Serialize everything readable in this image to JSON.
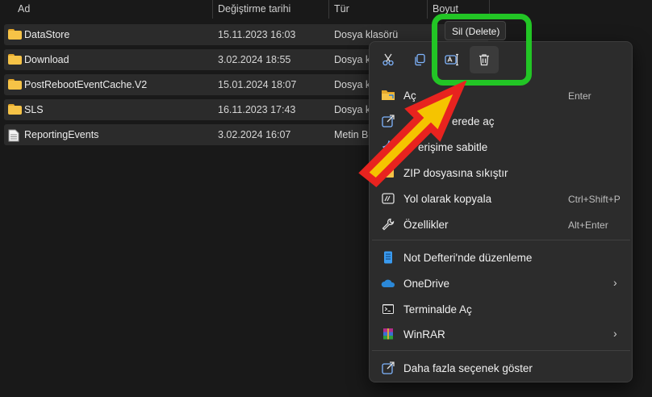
{
  "columns": {
    "name": "Ad",
    "modified": "Değiştirme tarihi",
    "type": "Tür",
    "size": "Boyut"
  },
  "files": [
    {
      "name": "DataStore",
      "date": "15.11.2023 16:03",
      "type": "Dosya klasörü",
      "icon": "folder-icon"
    },
    {
      "name": "Download",
      "date": "3.02.2024 18:55",
      "type": "Dosya kl",
      "icon": "folder-icon"
    },
    {
      "name": "PostRebootEventCache.V2",
      "date": "15.01.2024 18:07",
      "type": "Dosya kl",
      "icon": "folder-icon"
    },
    {
      "name": "SLS",
      "date": "16.11.2023 17:43",
      "type": "Dosya kl",
      "icon": "folder-icon"
    },
    {
      "name": "ReportingEvents",
      "date": "3.02.2024 16:07",
      "type": "Metin Be",
      "icon": "text-file-icon"
    }
  ],
  "tooltip": "Sil (Delete)",
  "quick_actions": [
    "cut-icon",
    "copy-icon",
    "rename-icon",
    "delete-icon"
  ],
  "menu": {
    "open": {
      "label": "Aç",
      "shortcut": "Enter"
    },
    "open_new_window": {
      "label": "erede aç"
    },
    "pin": {
      "label": "erişime sabitle"
    },
    "zip": {
      "label": "ZIP dosyasına sıkıştır"
    },
    "copy_path": {
      "label": "Yol olarak kopyala",
      "shortcut": "Ctrl+Shift+P"
    },
    "properties": {
      "label": "Özellikler",
      "shortcut": "Alt+Enter"
    },
    "notepad": {
      "label": "Not Defteri'nde düzenleme"
    },
    "onedrive": {
      "label": "OneDrive"
    },
    "terminal": {
      "label": "Terminalde Aç"
    },
    "winrar": {
      "label": "WinRAR"
    },
    "more": {
      "label": "Daha fazla seçenek göster"
    }
  },
  "colors": {
    "highlight_box": "#22c525",
    "arrow_fill": "#f5c400",
    "arrow_outline": "#e8231f",
    "folder": "#f6c347"
  }
}
